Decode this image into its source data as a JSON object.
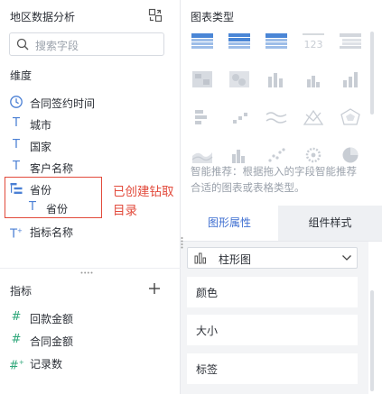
{
  "left_panel": {
    "title": "地区数据分析",
    "search_placeholder": "搜索字段",
    "dimension_label": "维度",
    "dimensions": [
      {
        "icon": "clock-icon",
        "glyph": "◷",
        "label": "合同签约时间"
      },
      {
        "icon": "text-type-icon",
        "glyph": "T",
        "label": "城市"
      },
      {
        "icon": "text-type-icon",
        "glyph": "T",
        "label": "国家"
      },
      {
        "icon": "text-type-icon",
        "glyph": "T",
        "label": "客户名称"
      },
      {
        "icon": "drill-hierarchy-icon",
        "glyph": "",
        "label": "省份"
      },
      {
        "icon": "text-type-icon",
        "glyph": "T",
        "label": "省份"
      },
      {
        "icon": "computed-text-type-icon",
        "glyph": "T",
        "label": "指标名称"
      }
    ],
    "drill_annotation": "已创建钻取目录",
    "measure_label": "指标",
    "measures": [
      {
        "icon": "number-type-icon",
        "glyph": "#",
        "label": "回款金额"
      },
      {
        "icon": "number-type-icon",
        "glyph": "#",
        "label": "合同金额"
      },
      {
        "icon": "computed-number-type-icon",
        "glyph": "#",
        "label": "记录数"
      }
    ]
  },
  "right_panel": {
    "title": "图表类型",
    "chart_types": [
      "table-chart-icon",
      "cross-table-chart-icon",
      "detail-table-chart-icon",
      "kpi-number-chart-icon",
      "tree-table-chart-icon",
      "map-chart-icon",
      "heat-map-chart-icon",
      "multi-bar-chart-icon",
      "bar-chart-icon",
      "stacked-bar-chart-icon",
      "funnel-chart-icon",
      "area-step-chart-icon",
      "line-chart-icon",
      "radar-line-chart-icon",
      "radar-chart-icon",
      "area-chart-icon",
      "grouped-bar-chart-icon",
      "scatter-chart-icon",
      "bubble-chart-icon",
      "pie-chart-icon"
    ],
    "description": "智能推荐：根据拖入的字段智能推荐合适的图表或表格类型。",
    "tabs": {
      "active": "图形属性",
      "inactive": "组件样式"
    },
    "chart_select": "柱形图",
    "props": [
      "颜色",
      "大小",
      "标签"
    ],
    "colors": {
      "accent": "#3f6fd1",
      "annotation": "#e24a3b",
      "field_icon": "#4a7fd4",
      "chart_icon_active": "#4a86d6",
      "chart_icon_muted": "#c8cdd4"
    }
  }
}
